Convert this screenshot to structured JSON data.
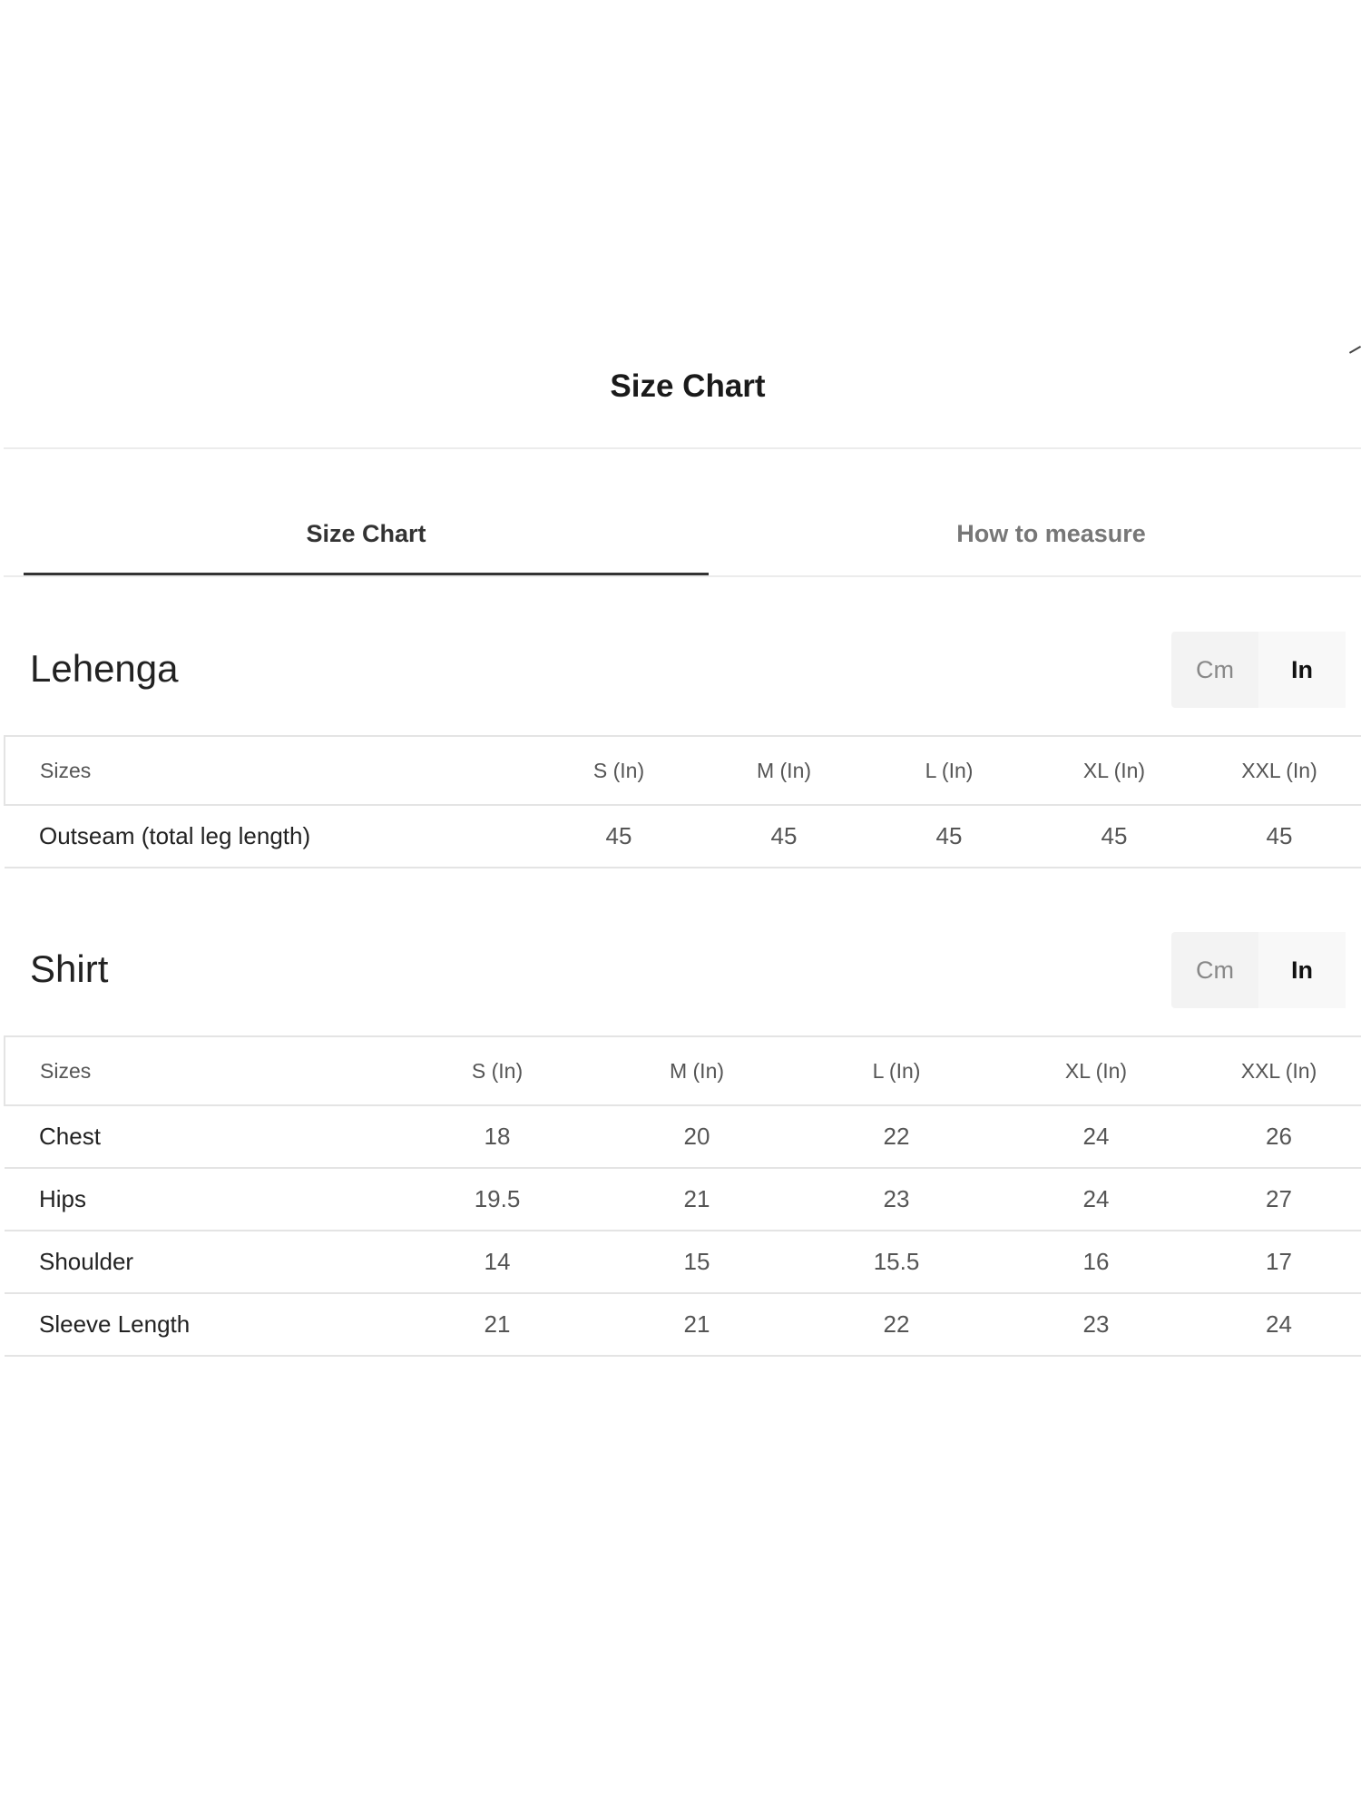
{
  "modal": {
    "title": "Size Chart"
  },
  "tabs": [
    {
      "label": "Size Chart",
      "active": true
    },
    {
      "label": "How to measure",
      "active": false
    }
  ],
  "units": {
    "cm": "Cm",
    "in": "In",
    "selected": "In"
  },
  "sections": {
    "lehenga": {
      "title": "Lehenga",
      "headers": [
        "Sizes",
        "S (In)",
        "M (In)",
        "L (In)",
        "XL (In)",
        "XXL (In)"
      ],
      "rows": [
        {
          "label": "Outseam (total leg length)",
          "values": [
            "45",
            "45",
            "45",
            "45",
            "45"
          ]
        }
      ]
    },
    "shirt": {
      "title": "Shirt",
      "headers": [
        "Sizes",
        "S (In)",
        "M (In)",
        "L (In)",
        "XL (In)",
        "XXL (In)"
      ],
      "rows": [
        {
          "label": "Chest",
          "values": [
            "18",
            "20",
            "22",
            "24",
            "26"
          ]
        },
        {
          "label": "Hips",
          "values": [
            "19.5",
            "21",
            "23",
            "24",
            "27"
          ]
        },
        {
          "label": "Shoulder",
          "values": [
            "14",
            "15",
            "15.5",
            "16",
            "17"
          ]
        },
        {
          "label": "Sleeve Length",
          "values": [
            "21",
            "21",
            "22",
            "23",
            "24"
          ]
        }
      ]
    }
  },
  "colors": {
    "accent": "#333333",
    "border": "#e4e4e4",
    "toggle_bg": "#f3f3f3"
  }
}
